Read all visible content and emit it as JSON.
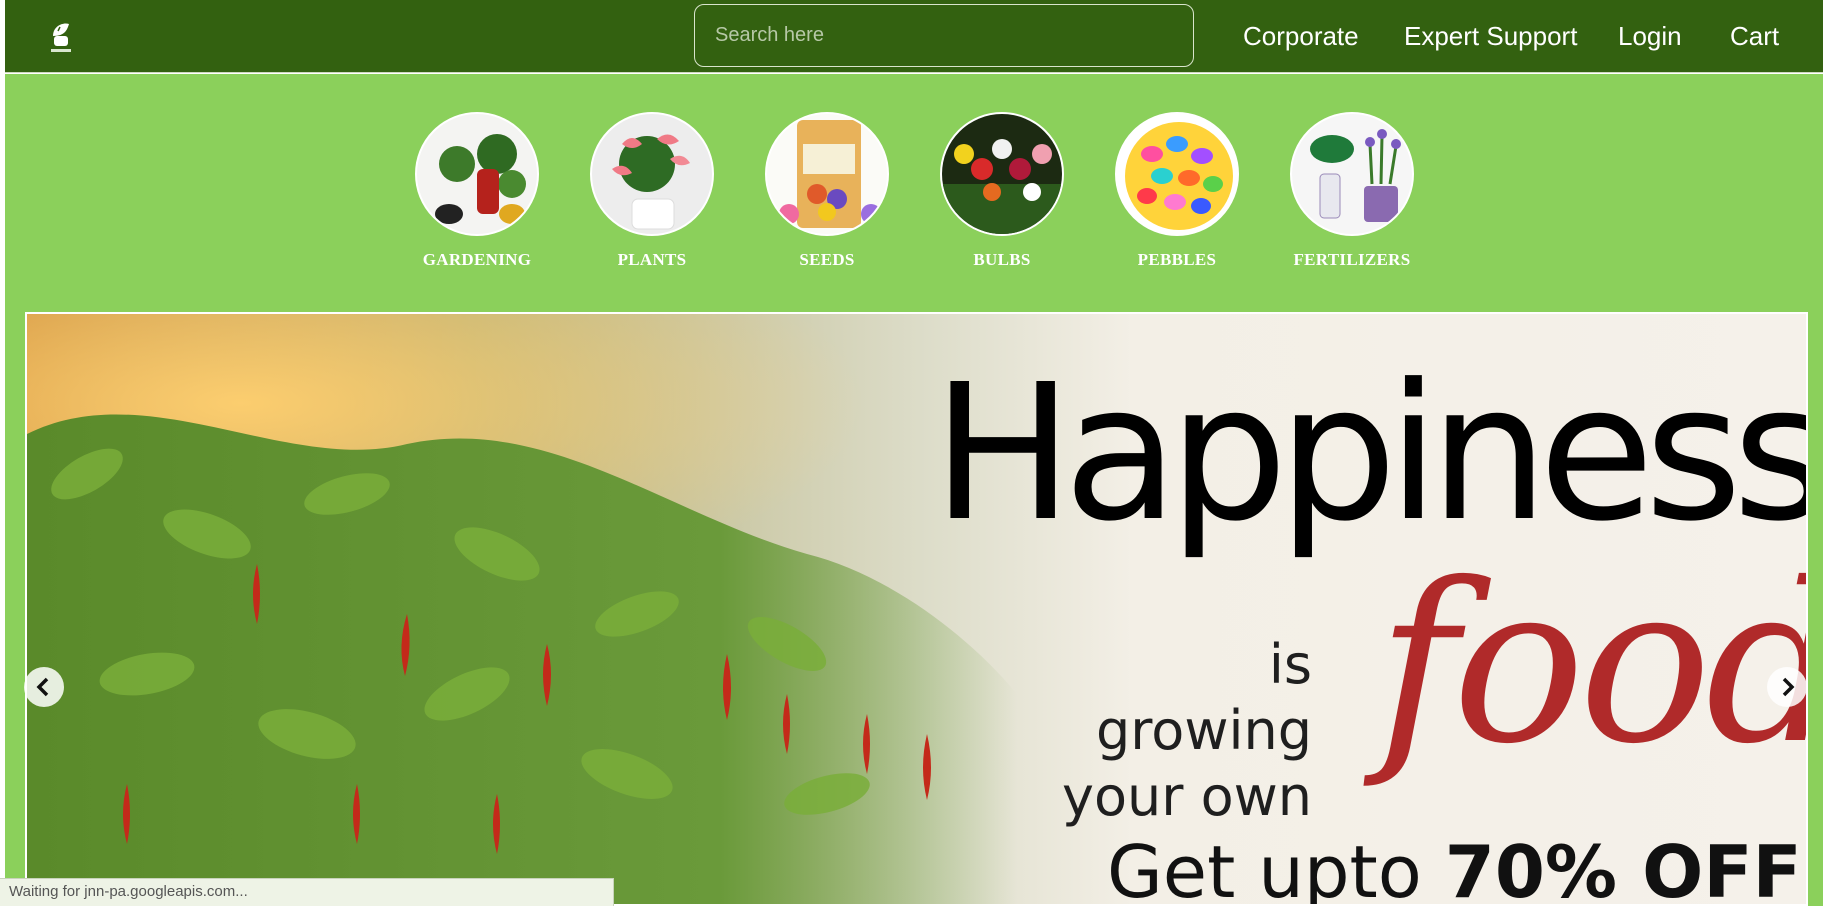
{
  "header": {
    "search_placeholder": "Search here",
    "nav": [
      "Corporate",
      "Expert Support",
      "Login",
      "Cart"
    ],
    "logo_icon": "green-leaf-logo-icon"
  },
  "categories": [
    {
      "label": "GARDENING"
    },
    {
      "label": "PLANTS"
    },
    {
      "label": "SEEDS"
    },
    {
      "label": "BULBS"
    },
    {
      "label": "PEBBLES"
    },
    {
      "label": "FERTILIZERS"
    }
  ],
  "banner": {
    "headline": "Happiness",
    "subline_1": "is growing",
    "subline_2": "your own",
    "script_word": "food",
    "offer_prefix": "Get upto",
    "offer_value": "70% OFF"
  },
  "carousel": {
    "prev_icon": "chevron-left-icon",
    "next_icon": "chevron-right-icon"
  },
  "status_bar": {
    "text": "Waiting for jnn-pa.googleapis.com..."
  },
  "colors": {
    "navbar": "#336110",
    "category_band": "#8bd05b",
    "script_red": "#b02a2a"
  }
}
